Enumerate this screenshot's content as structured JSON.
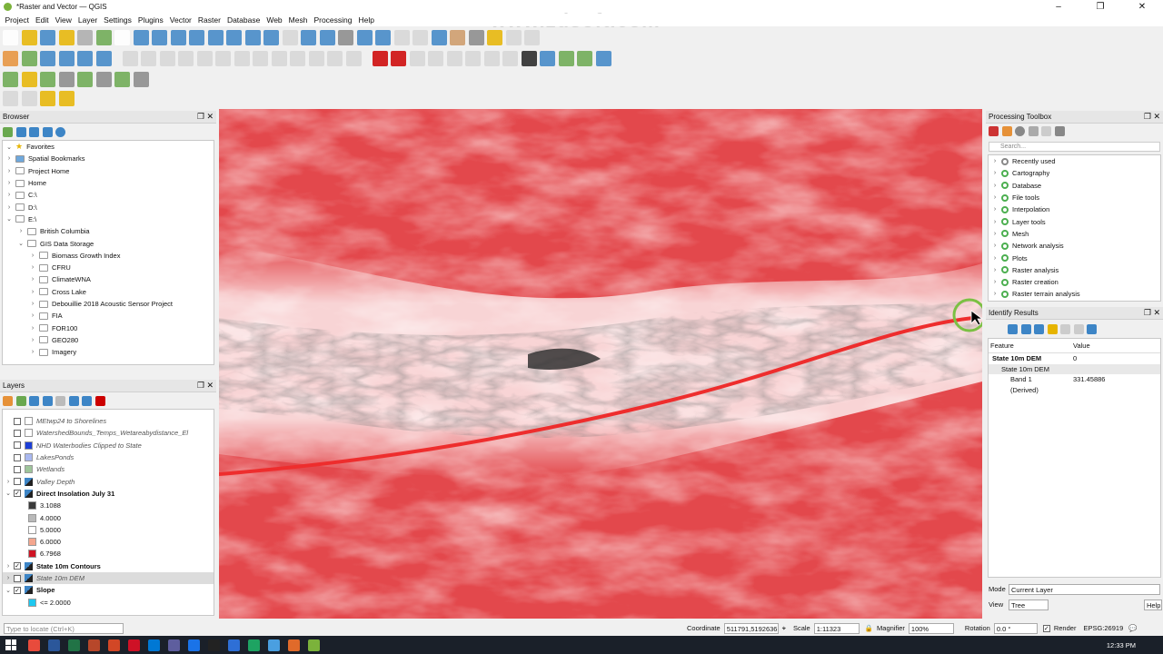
{
  "window": {
    "title": "*Raster and Vector — QGIS"
  },
  "watermark": "www.zdsoft.com",
  "menu": [
    "Project",
    "Edit",
    "View",
    "Layer",
    "Settings",
    "Plugins",
    "Vector",
    "Raster",
    "Database",
    "Web",
    "Mesh",
    "Processing",
    "Help"
  ],
  "browser": {
    "title": "Browser",
    "items": [
      {
        "label": "Favorites",
        "indent": 0,
        "icon": "star-icon",
        "expanded": true
      },
      {
        "label": "Spatial Bookmarks",
        "indent": 0,
        "icon": "bookmark-icon"
      },
      {
        "label": "Project Home",
        "indent": 0,
        "icon": "folder-icon"
      },
      {
        "label": "Home",
        "indent": 0,
        "icon": "folder-icon"
      },
      {
        "label": "C:\\",
        "indent": 0,
        "icon": "drive-icon"
      },
      {
        "label": "D:\\",
        "indent": 0,
        "icon": "drive-icon"
      },
      {
        "label": "E:\\",
        "indent": 0,
        "icon": "drive-icon",
        "expanded": true
      },
      {
        "label": "British Columbia",
        "indent": 1,
        "icon": "folder-icon"
      },
      {
        "label": "GIS Data Storage",
        "indent": 1,
        "icon": "folder-icon",
        "expanded": true
      },
      {
        "label": "Biomass Growth Index",
        "indent": 2,
        "icon": "folder-icon"
      },
      {
        "label": "CFRU",
        "indent": 2,
        "icon": "folder-icon"
      },
      {
        "label": "ClimateWNA",
        "indent": 2,
        "icon": "folder-icon"
      },
      {
        "label": "Cross Lake",
        "indent": 2,
        "icon": "folder-icon"
      },
      {
        "label": "Debouillie 2018 Acoustic Sensor Project",
        "indent": 2,
        "icon": "folder-icon"
      },
      {
        "label": "FIA",
        "indent": 2,
        "icon": "folder-icon"
      },
      {
        "label": "FOR100",
        "indent": 2,
        "icon": "folder-icon"
      },
      {
        "label": "GEO280",
        "indent": 2,
        "icon": "folder-icon"
      },
      {
        "label": "Imagery",
        "indent": 2,
        "icon": "folder-icon"
      }
    ]
  },
  "layers": {
    "title": "Layers",
    "items": [
      {
        "label": "MEtwp24 to Shorelines",
        "checked": false,
        "style": "italic",
        "swatch": "#ffffff"
      },
      {
        "label": "WatershedBounds_Temps_Wetareabydistance_El",
        "checked": false,
        "style": "italic",
        "swatch": "#ffffff"
      },
      {
        "label": "NHD Waterbodies Clipped to State",
        "checked": false,
        "style": "italic",
        "swatch": "#1d3fd6"
      },
      {
        "label": "LakesPonds",
        "checked": false,
        "style": "italic",
        "swatch": "#a9b8f0"
      },
      {
        "label": "Wetlands",
        "checked": false,
        "style": "italic",
        "swatch": "#9ec59a"
      },
      {
        "label": "Valley Depth",
        "checked": false,
        "style": "italic",
        "swatch": "raster"
      },
      {
        "label": "Direct Insolation July 31",
        "checked": true,
        "style": "bold",
        "swatch": "raster",
        "expanded": true
      },
      {
        "label": "3.1088",
        "legend": true,
        "swatch": "#3a3a3a"
      },
      {
        "label": "4.0000",
        "legend": true,
        "swatch": "#b9b9b9"
      },
      {
        "label": "5.0000",
        "legend": true,
        "swatch": "#ffffff"
      },
      {
        "label": "6.0000",
        "legend": true,
        "swatch": "#f4a68e"
      },
      {
        "label": "6.7968",
        "legend": true,
        "swatch": "#cf1424"
      },
      {
        "label": "State 10m Contours",
        "checked": true,
        "style": "bold",
        "swatch": "raster"
      },
      {
        "label": "State 10m DEM",
        "checked": false,
        "style": "italic",
        "swatch": "raster",
        "selected": true
      },
      {
        "label": "Slope",
        "checked": true,
        "style": "bold",
        "swatch": "raster",
        "expanded": true
      },
      {
        "label": "<= 2.0000",
        "legend": true,
        "swatch": "#1ec8f0"
      }
    ]
  },
  "locator": {
    "placeholder": "Type to locate (Ctrl+K)"
  },
  "status": {
    "coordinate_label": "Coordinate",
    "coordinate": "511791,5192636",
    "scale_label": "Scale",
    "scale": "1:11323",
    "magnifier_label": "Magnifier",
    "magnifier": "100%",
    "rotation_label": "Rotation",
    "rotation": "0.0 °",
    "render_label": "Render",
    "crs": "EPSG:26919"
  },
  "toolbox": {
    "title": "Processing Toolbox",
    "search_placeholder": "Search...",
    "items": [
      "Recently used",
      "Cartography",
      "Database",
      "File tools",
      "Interpolation",
      "Layer tools",
      "Mesh",
      "Network analysis",
      "Plots",
      "Raster analysis",
      "Raster creation",
      "Raster terrain analysis"
    ]
  },
  "identify": {
    "title": "Identify Results",
    "col_feature": "Feature",
    "col_value": "Value",
    "rows": [
      {
        "feature": "State 10m DEM",
        "value": "0",
        "indent": 0,
        "bold": true
      },
      {
        "feature": "State 10m DEM",
        "value": "",
        "indent": 1,
        "highlight": true
      },
      {
        "feature": "Band 1",
        "value": "331.45886",
        "indent": 2
      },
      {
        "feature": "(Derived)",
        "value": "",
        "indent": 2
      }
    ],
    "mode_label": "Mode",
    "mode_value": "Current Layer",
    "view_label": "View",
    "view_value": "Tree",
    "help_label": "Help"
  },
  "taskbar": {
    "time": "12:33 PM",
    "colors": [
      "#ffffff",
      "#ffffff",
      "#ffffff",
      "#ffffff",
      "#e84b3c",
      "#2b579a",
      "#217346",
      "#b7472a",
      "#d24726",
      "#ce1126",
      "#0078d4",
      "#5e5e9e",
      "#1a73e8",
      "#222222",
      "#2e6fd6",
      "#1ea362",
      "#4a9fe0",
      "#e06a2a",
      "#7bb23b"
    ]
  }
}
